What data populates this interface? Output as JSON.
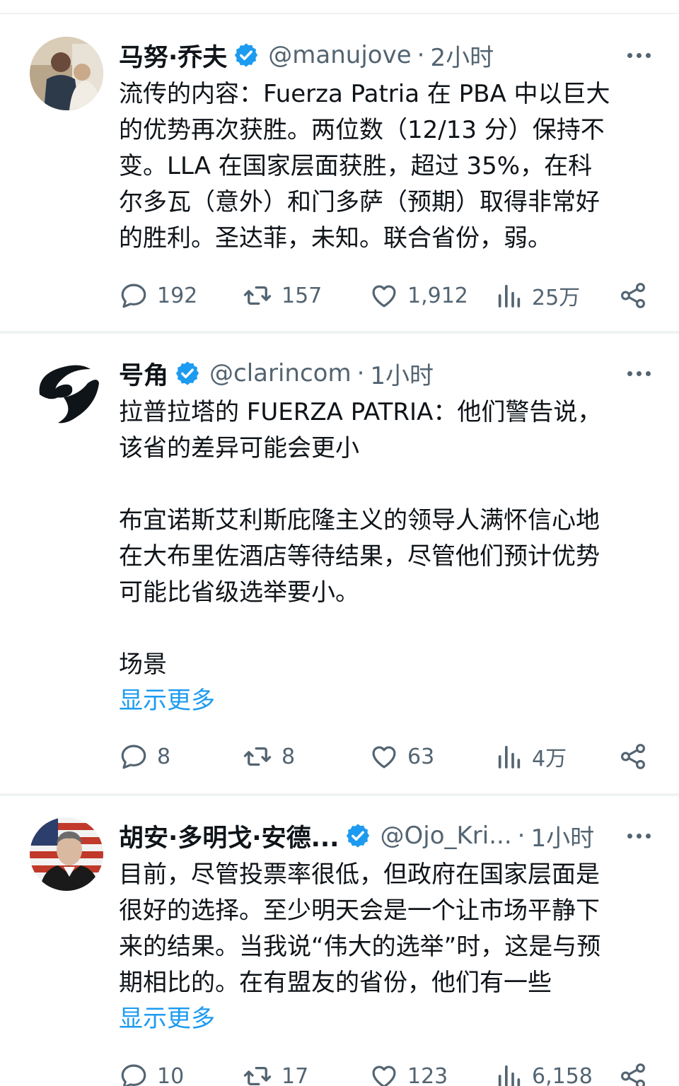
{
  "tweets": [
    {
      "name": "马努·乔夫",
      "handle": "@manujove",
      "separator": "·",
      "time": "2小时",
      "paragraphs": [
        "流传的内容：Fuerza Patria 在 PBA 中以巨大",
        "的优势再次获胜。两位数（12/13 分）保持不",
        "变。LLA 在国家层面获胜，超过 35%，在科",
        "尔多瓦（意外）和门多萨（预期）取得非常好",
        "的胜利。圣达菲，未知。联合省份，弱。"
      ],
      "show_more": "",
      "stats": {
        "replies": "192",
        "retweets": "157",
        "likes": "1,912",
        "views": "25万"
      }
    },
    {
      "name": "号角",
      "handle": "@clarincom",
      "separator": "·",
      "time": "1小时",
      "lines_block1": [
        "拉普拉塔的 FUERZA PATRIA：他们警告说，",
        "该省的差异可能会更小"
      ],
      "lines_block2": [
        "布宜诺斯艾利斯庇隆主义的领导人满怀信心地",
        "在大布里佐酒店等待结果，尽管他们预计优势",
        "可能比省级选举要小。"
      ],
      "lines_block3": [
        "场景"
      ],
      "show_more": "显示更多",
      "stats": {
        "replies": "8",
        "retweets": "8",
        "likes": "63",
        "views": "4万"
      }
    },
    {
      "name": "胡安·多明戈·安德...",
      "handle": "@Ojo_Kri...",
      "separator": "·",
      "time": "1小时",
      "paragraphs": [
        "目前，尽管投票率很低，但政府在国家层面是",
        "很好的选择。至少明天会是一个让市场平静下",
        "来的结果。当我说“伟大的选举”时，这是与预",
        "期相比的。在有盟友的省份，他们有一些"
      ],
      "show_more": "显示更多",
      "stats": {
        "replies": "10",
        "retweets": "17",
        "likes": "123",
        "views": "6,158"
      }
    }
  ],
  "icons": {
    "verified": "verified-badge-icon",
    "more": "more-horizontal-icon",
    "reply": "reply-icon",
    "retweet": "retweet-icon",
    "like": "heart-icon",
    "views": "views-chart-icon",
    "share": "share-icon"
  },
  "colors": {
    "text": "#0f1419",
    "secondary": "#536471",
    "link": "#1d9bf0",
    "verified": "#1d9bf0",
    "divider": "#eff3f4"
  }
}
